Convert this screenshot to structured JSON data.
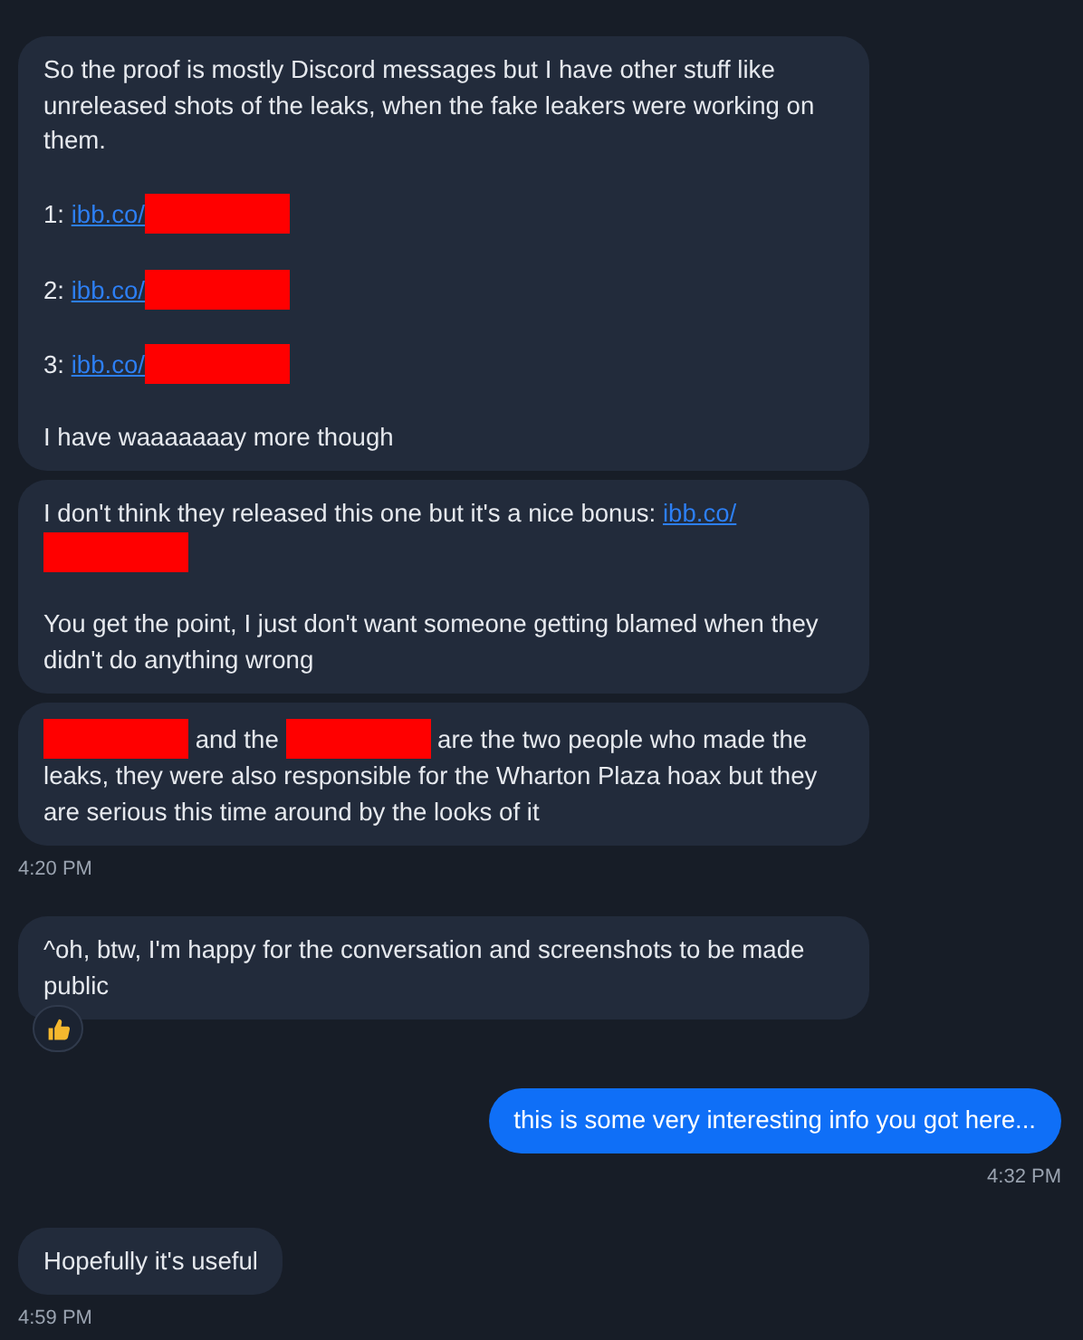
{
  "groups": [
    {
      "outgoing": false,
      "time": "4:20 PM",
      "messages": [
        {
          "reacted": false,
          "paragraphs": [
            [
              {
                "kind": "text",
                "text": "So the proof is mostly Discord messages but I have other stuff like unreleased shots of the leaks, when the fake leakers were working on them."
              }
            ],
            [
              {
                "kind": "text",
                "text": "1: "
              },
              {
                "kind": "link",
                "text": "ibb.co/"
              },
              {
                "kind": "redacted"
              }
            ],
            [
              {
                "kind": "text",
                "text": "2: "
              },
              {
                "kind": "link",
                "text": "ibb.co/"
              },
              {
                "kind": "redacted"
              }
            ],
            [
              {
                "kind": "text",
                "text": "3: "
              },
              {
                "kind": "link",
                "text": "ibb.co/"
              },
              {
                "kind": "redacted"
              }
            ],
            [
              {
                "kind": "text",
                "text": "I have waaaaaaay more though"
              }
            ]
          ]
        },
        {
          "reacted": false,
          "paragraphs": [
            [
              {
                "kind": "text",
                "text": "I don't think they released this one but it's a nice bonus: "
              },
              {
                "kind": "link",
                "text": "ibb.co/"
              },
              {
                "kind": "redacted"
              }
            ],
            [
              {
                "kind": "text",
                "text": "You get the point, I just don't want someone getting blamed when they didn't do anything wrong"
              }
            ]
          ]
        },
        {
          "reacted": false,
          "paragraphs": [
            [
              {
                "kind": "redacted"
              },
              {
                "kind": "text",
                "text": " and the "
              },
              {
                "kind": "redacted"
              },
              {
                "kind": "text",
                "text": " are the two people who made the leaks, they were also responsible for the Wharton Plaza hoax but they are serious this time around by the looks of it"
              }
            ]
          ]
        }
      ]
    },
    {
      "outgoing": false,
      "messages": [
        {
          "reacted": true,
          "paragraphs": [
            [
              {
                "kind": "text",
                "text": "^oh, btw, I'm happy for the conversation and screenshots to be made public"
              }
            ]
          ]
        }
      ]
    },
    {
      "outgoing": true,
      "time": "4:32 PM",
      "messages": [
        {
          "reacted": false,
          "paragraphs": [
            [
              {
                "kind": "text",
                "text": "this is some very interesting info you got here..."
              }
            ]
          ]
        }
      ]
    },
    {
      "outgoing": false,
      "time": "4:59 PM",
      "messages": [
        {
          "reacted": false,
          "paragraphs": [
            [
              {
                "kind": "text",
                "text": "Hopefully it's useful"
              }
            ]
          ]
        }
      ]
    }
  ]
}
